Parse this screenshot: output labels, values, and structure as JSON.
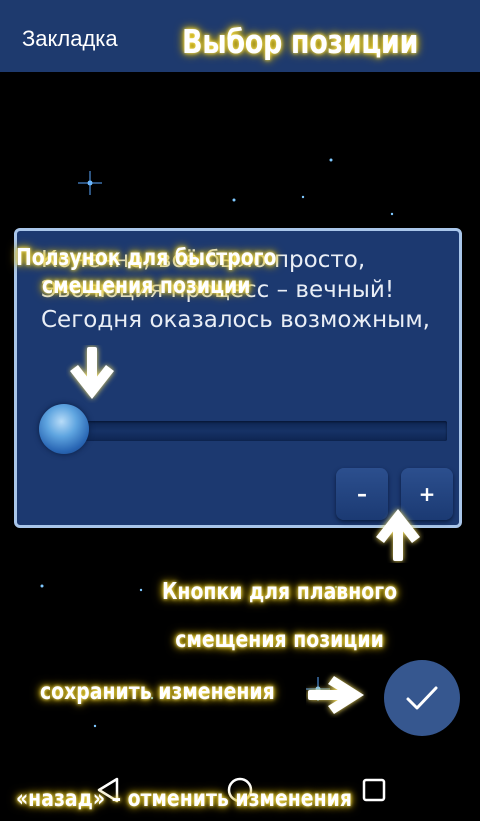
{
  "topbar": {
    "title": "Закладка"
  },
  "annotations": {
    "title": "Выбор позиции",
    "slider_line1": "Ползунок для быстрого",
    "slider_line2": "смещения позиции",
    "buttons_line1": "Кнопки для плавного",
    "buttons_line2": "смещения позиции",
    "save": "сохранить изменения",
    "back": "«назад» – отменить изменения"
  },
  "panel": {
    "quote": "Конечно, всё было просто,\nЭволюция процесс – вечный!\nСегодня оказалось возможным,",
    "slider_position": 0.0,
    "minus_label": "–",
    "plus_label": "+"
  },
  "icons": {
    "fab": "check-icon",
    "nav_back": "triangle-back-icon",
    "nav_home": "circle-home-icon",
    "nav_recents": "square-recents-icon"
  },
  "colors": {
    "topbar": "#1e3a6e",
    "panel": "#1c3970",
    "panel_border": "#a9c6ea",
    "fab": "#36578f",
    "annotation_glow": "#ffe866"
  }
}
